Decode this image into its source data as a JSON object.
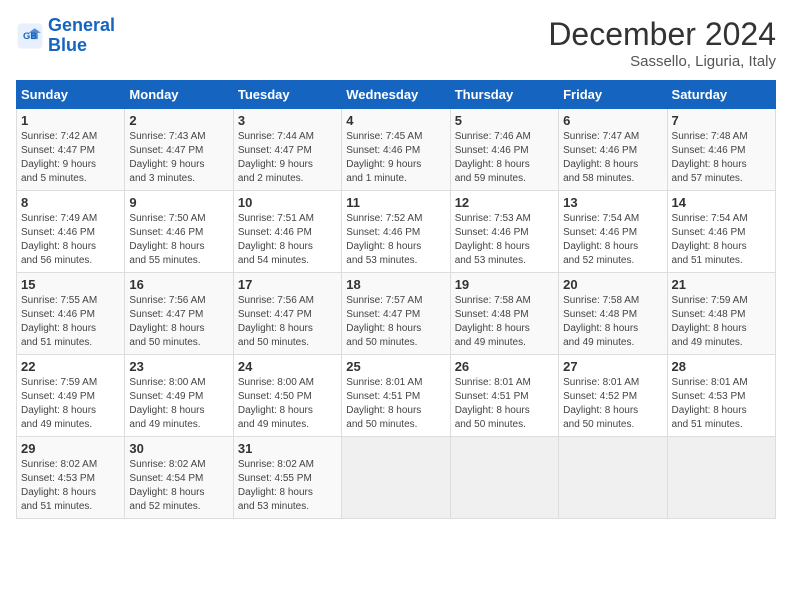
{
  "header": {
    "logo_line1": "General",
    "logo_line2": "Blue",
    "month_title": "December 2024",
    "subtitle": "Sassello, Liguria, Italy"
  },
  "days_of_week": [
    "Sunday",
    "Monday",
    "Tuesday",
    "Wednesday",
    "Thursday",
    "Friday",
    "Saturday"
  ],
  "weeks": [
    [
      {
        "day": "1",
        "info": "Sunrise: 7:42 AM\nSunset: 4:47 PM\nDaylight: 9 hours\nand 5 minutes."
      },
      {
        "day": "2",
        "info": "Sunrise: 7:43 AM\nSunset: 4:47 PM\nDaylight: 9 hours\nand 3 minutes."
      },
      {
        "day": "3",
        "info": "Sunrise: 7:44 AM\nSunset: 4:47 PM\nDaylight: 9 hours\nand 2 minutes."
      },
      {
        "day": "4",
        "info": "Sunrise: 7:45 AM\nSunset: 4:46 PM\nDaylight: 9 hours\nand 1 minute."
      },
      {
        "day": "5",
        "info": "Sunrise: 7:46 AM\nSunset: 4:46 PM\nDaylight: 8 hours\nand 59 minutes."
      },
      {
        "day": "6",
        "info": "Sunrise: 7:47 AM\nSunset: 4:46 PM\nDaylight: 8 hours\nand 58 minutes."
      },
      {
        "day": "7",
        "info": "Sunrise: 7:48 AM\nSunset: 4:46 PM\nDaylight: 8 hours\nand 57 minutes."
      }
    ],
    [
      {
        "day": "8",
        "info": "Sunrise: 7:49 AM\nSunset: 4:46 PM\nDaylight: 8 hours\nand 56 minutes."
      },
      {
        "day": "9",
        "info": "Sunrise: 7:50 AM\nSunset: 4:46 PM\nDaylight: 8 hours\nand 55 minutes."
      },
      {
        "day": "10",
        "info": "Sunrise: 7:51 AM\nSunset: 4:46 PM\nDaylight: 8 hours\nand 54 minutes."
      },
      {
        "day": "11",
        "info": "Sunrise: 7:52 AM\nSunset: 4:46 PM\nDaylight: 8 hours\nand 53 minutes."
      },
      {
        "day": "12",
        "info": "Sunrise: 7:53 AM\nSunset: 4:46 PM\nDaylight: 8 hours\nand 53 minutes."
      },
      {
        "day": "13",
        "info": "Sunrise: 7:54 AM\nSunset: 4:46 PM\nDaylight: 8 hours\nand 52 minutes."
      },
      {
        "day": "14",
        "info": "Sunrise: 7:54 AM\nSunset: 4:46 PM\nDaylight: 8 hours\nand 51 minutes."
      }
    ],
    [
      {
        "day": "15",
        "info": "Sunrise: 7:55 AM\nSunset: 4:46 PM\nDaylight: 8 hours\nand 51 minutes."
      },
      {
        "day": "16",
        "info": "Sunrise: 7:56 AM\nSunset: 4:47 PM\nDaylight: 8 hours\nand 50 minutes."
      },
      {
        "day": "17",
        "info": "Sunrise: 7:56 AM\nSunset: 4:47 PM\nDaylight: 8 hours\nand 50 minutes."
      },
      {
        "day": "18",
        "info": "Sunrise: 7:57 AM\nSunset: 4:47 PM\nDaylight: 8 hours\nand 50 minutes."
      },
      {
        "day": "19",
        "info": "Sunrise: 7:58 AM\nSunset: 4:48 PM\nDaylight: 8 hours\nand 49 minutes."
      },
      {
        "day": "20",
        "info": "Sunrise: 7:58 AM\nSunset: 4:48 PM\nDaylight: 8 hours\nand 49 minutes."
      },
      {
        "day": "21",
        "info": "Sunrise: 7:59 AM\nSunset: 4:48 PM\nDaylight: 8 hours\nand 49 minutes."
      }
    ],
    [
      {
        "day": "22",
        "info": "Sunrise: 7:59 AM\nSunset: 4:49 PM\nDaylight: 8 hours\nand 49 minutes."
      },
      {
        "day": "23",
        "info": "Sunrise: 8:00 AM\nSunset: 4:49 PM\nDaylight: 8 hours\nand 49 minutes."
      },
      {
        "day": "24",
        "info": "Sunrise: 8:00 AM\nSunset: 4:50 PM\nDaylight: 8 hours\nand 49 minutes."
      },
      {
        "day": "25",
        "info": "Sunrise: 8:01 AM\nSunset: 4:51 PM\nDaylight: 8 hours\nand 50 minutes."
      },
      {
        "day": "26",
        "info": "Sunrise: 8:01 AM\nSunset: 4:51 PM\nDaylight: 8 hours\nand 50 minutes."
      },
      {
        "day": "27",
        "info": "Sunrise: 8:01 AM\nSunset: 4:52 PM\nDaylight: 8 hours\nand 50 minutes."
      },
      {
        "day": "28",
        "info": "Sunrise: 8:01 AM\nSunset: 4:53 PM\nDaylight: 8 hours\nand 51 minutes."
      }
    ],
    [
      {
        "day": "29",
        "info": "Sunrise: 8:02 AM\nSunset: 4:53 PM\nDaylight: 8 hours\nand 51 minutes."
      },
      {
        "day": "30",
        "info": "Sunrise: 8:02 AM\nSunset: 4:54 PM\nDaylight: 8 hours\nand 52 minutes."
      },
      {
        "day": "31",
        "info": "Sunrise: 8:02 AM\nSunset: 4:55 PM\nDaylight: 8 hours\nand 53 minutes."
      },
      null,
      null,
      null,
      null
    ]
  ]
}
